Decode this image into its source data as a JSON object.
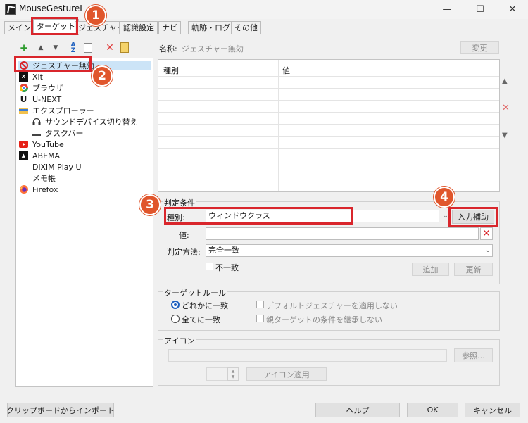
{
  "window": {
    "title": "MouseGestureL",
    "controls": [
      "—",
      "☐",
      "✕"
    ]
  },
  "tabs": [
    {
      "label": "メイン"
    },
    {
      "label": "ターゲット"
    },
    {
      "label": "ジェスチャー"
    },
    {
      "label": "認識設定"
    },
    {
      "label": "ナビ"
    },
    {
      "label": "軌跡・ログ"
    },
    {
      "label": "その他"
    }
  ],
  "toolbar": {
    "icons": [
      "add-icon",
      "move-up-icon",
      "move-down-icon",
      "sort-icon",
      "copy-icon",
      "delete-icon",
      "paste-icon"
    ]
  },
  "tree": {
    "items": [
      {
        "label": "ジェスチャー無効",
        "icon": "disabled-icon"
      },
      {
        "label": "Xit",
        "icon": "xit-icon"
      },
      {
        "label": "ブラウザ",
        "icon": "chrome-icon"
      },
      {
        "label": "U-NEXT",
        "icon": "unext-icon"
      },
      {
        "label": "エクスプローラー",
        "icon": "folder-icon"
      },
      {
        "label": "サウンドデバイス切り替え",
        "icon": "headphones-icon"
      },
      {
        "label": "タスクバー",
        "icon": "taskbar-icon"
      },
      {
        "label": "YouTube",
        "icon": "youtube-icon"
      },
      {
        "label": "ABEMA",
        "icon": "abema-icon"
      },
      {
        "label": "DiXiM Play U",
        "icon": ""
      },
      {
        "label": "メモ帳",
        "icon": ""
      },
      {
        "label": "Firefox",
        "icon": "firefox-icon"
      }
    ]
  },
  "name_field": {
    "label": "名称:",
    "value": "ジェスチャー無効",
    "change_button": "変更"
  },
  "conditions_table": {
    "columns": [
      "種別",
      "値"
    ]
  },
  "criteria": {
    "group_label": "判定条件",
    "type_label": "種別:",
    "type_value": "ウィンドウクラス",
    "assist_button": "入力補助",
    "value_label": "値:",
    "value_value": "",
    "method_label": "判定方法:",
    "method_value": "完全一致",
    "mismatch_label": "不一致",
    "add_button": "追加",
    "update_button": "更新"
  },
  "target_rule": {
    "group_label": "ターゲットルール",
    "radio_any": "どれかに一致",
    "radio_all": "全てに一致",
    "check_default": "デフォルトジェスチャーを適用しない",
    "check_parent": "親ターゲットの条件を継承しない"
  },
  "icon_section": {
    "group_label": "アイコン",
    "browse_button": "参照...",
    "apply_button": "アイコン適用"
  },
  "footer": {
    "import_button": "クリップボードからインポート",
    "help_button": "ヘルプ",
    "ok_button": "OK",
    "cancel_button": "キャンセル"
  },
  "annotations": [
    "1",
    "2",
    "3",
    "4"
  ],
  "colors": {
    "accent_badge": "#e0562c",
    "highlight_box": "#d9262c",
    "radio_selected": "#1d5fbf"
  }
}
